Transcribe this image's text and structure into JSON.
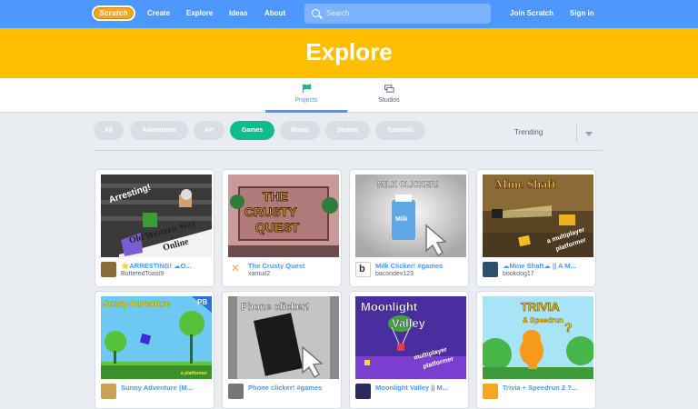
{
  "nav": {
    "logo": "Scratch",
    "links": [
      "Create",
      "Explore",
      "Ideas",
      "About"
    ],
    "search_placeholder": "Search",
    "join": "Join Scratch",
    "signin": "Sign in"
  },
  "hero": {
    "title": "Explore"
  },
  "tabs": [
    {
      "label": "Projects",
      "icon": "flag-icon",
      "active": true
    },
    {
      "label": "Studios",
      "icon": "studio-icon",
      "active": false
    }
  ],
  "categories": [
    {
      "label": "All",
      "active": false
    },
    {
      "label": "Animations",
      "active": false
    },
    {
      "label": "Art",
      "active": false
    },
    {
      "label": "Games",
      "active": true
    },
    {
      "label": "Music",
      "active": false
    },
    {
      "label": "Stories",
      "active": false
    },
    {
      "label": "Tutorials",
      "active": false
    }
  ],
  "sort": {
    "selected": "Trending"
  },
  "colors": {
    "nav": "#4d97ff",
    "hero": "#ffbf00",
    "active_pill": "#0fbd8c",
    "link": "#4c97ff"
  },
  "projects": [
    {
      "title": "⭐ARRESTING! ☁O...",
      "author": "ButteredToast9",
      "thumb_text": [
        "Arresting!",
        "Old Western Way",
        "Online"
      ]
    },
    {
      "title": "The Crusty Quest",
      "author": "xamuil2",
      "thumb_text": [
        "THE",
        "CRUSTY",
        "QUEST"
      ]
    },
    {
      "title": "Milk Clicker! #games",
      "author": "bacondev123",
      "thumb_text": [
        "MILK CLICKER!",
        "Milk"
      ]
    },
    {
      "title": "☁Mine Shaft☁ || A M...",
      "author": "bookdog17",
      "thumb_text": [
        "Mine Shaft",
        "a multiplayer",
        "platformer"
      ]
    },
    {
      "title": "Sunny Adventure (M...",
      "author": "",
      "thumb_text": [
        "Sunny Adventure",
        "PB",
        "a platformer"
      ]
    },
    {
      "title": "Phone clicker! #games",
      "author": "",
      "thumb_text": [
        "Phone clicker!"
      ]
    },
    {
      "title": "Moonlight Valley || M...",
      "author": "",
      "thumb_text": [
        "Moonlight",
        "Valley",
        "multiplayer",
        "platformer"
      ]
    },
    {
      "title": "Trivia + Speedrun 2 ?...",
      "author": "",
      "thumb_text": [
        "TRIVIA",
        "& Speedrun",
        "?"
      ]
    }
  ]
}
